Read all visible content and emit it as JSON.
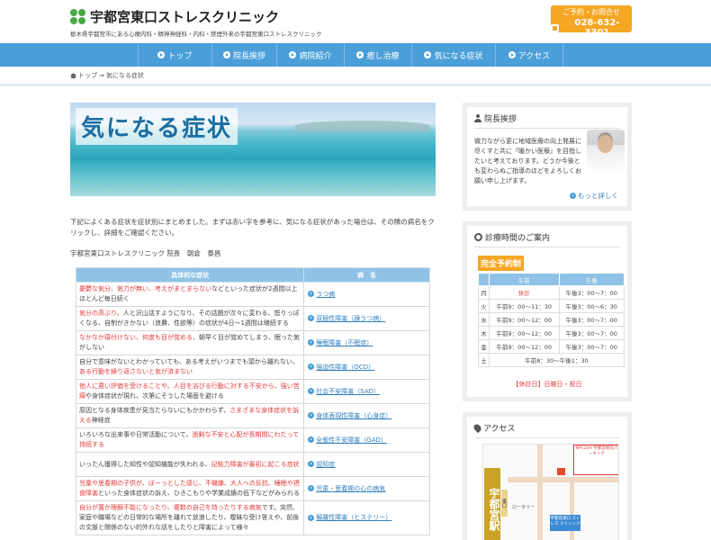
{
  "header": {
    "site_title": "宇都宮東口ストレスクリニック",
    "tagline": "栃木県宇都宮市にある心療内科・精神神経科・内科・禁煙外来の宇都宮東口ストレスクリニック",
    "contact_label": "ご予約・お問合せ",
    "phone": "028-632-3301"
  },
  "nav": [
    {
      "label": "トップ"
    },
    {
      "label": "院長挨拶"
    },
    {
      "label": "病院紹介"
    },
    {
      "label": "癒し治療"
    },
    {
      "label": "気になる症状"
    },
    {
      "label": "アクセス"
    }
  ],
  "breadcrumb": {
    "home": "トップ",
    "separator": "⇒",
    "current": "気になる症状"
  },
  "hero_title": "気になる症状",
  "intro": "下記によくある症状を症状別にまとめました。まずは赤い字を参考に、気になる症状があった場合は、その隣の病名をクリックし、詳細をご確認ください。",
  "signature": "宇都宮東口ストレスクリニック 院長　朝倉　泰昌",
  "table": {
    "col1": "具体的な症状",
    "col2": "病　名",
    "rows": [
      {
        "pre": "",
        "red": "憂鬱な気分、気力が無い、考えがまとまらない",
        "post": "などといった症状が2週間以上ほとんど毎日続く",
        "disease": "うつ病"
      },
      {
        "pre": "",
        "red": "気分の高ぶり",
        "post": "、人と沢山話すようになり、その話題が次々に変わる、怒りっぽくなる、自制がきかない（浪費、性欲等）の症状が4日〜1週間は継続する",
        "disease": "双極性障害（躁うつ病）"
      },
      {
        "pre": "",
        "red": "なかなか寝付けない、何度も目が覚める",
        "post": "、朝早く目が覚めてしまう、眠った気がしない",
        "disease": "睡眠障害（不眠症）"
      },
      {
        "pre": "自分で意味がないとわかっていても、ある考えがいつまでも頭から離れない、",
        "red": "ある行動を繰り返さないと気が済まない",
        "post": "",
        "disease": "強迫性障害（OCD）"
      },
      {
        "pre": "",
        "red": "他人に悪い評価を受けることや、人目を浴びる行動に対する不安から、強い苦痛",
        "post": "や身体症状が現れ、次第にそうした場面を避ける",
        "disease": "社会不安障害（SAD）"
      },
      {
        "pre": "原因となる身体疾患が見当たらないにもかかわらず、",
        "red": "さまざまな身体症状を訴える",
        "post": "神経症",
        "disease": "身体表現性障害（心身症）"
      },
      {
        "pre": "いろいろな出来事や日常活動について、",
        "red": "過剰な不安と心配が長期間にわたって持続する",
        "post": "",
        "disease": "全般性不安障害（GAD）"
      },
      {
        "pre": "いったん獲得した知性や認知機能が失われる、",
        "red": "記銘力障害が最初に起こる症状",
        "post": "",
        "disease": "認知症"
      },
      {
        "pre": "",
        "red": "児童や思春期の子供が、ぼーっとした感じ、不機嫌、大人への反抗、睡眠や摂食障害",
        "post": "といった身体症状の訴え、ひきこもりや学業成績の低下などがみられる",
        "disease": "児童・思春期の心の病気"
      },
      {
        "pre": "",
        "red": "自分が置か理解不能になったり、複数の自己を持ったりする病気",
        "post": "です。突然、家庭や職場などの日常的な場所を離れて放浪したり、曖昧な受け答えや、前後の文脈と関係のない的外れな話をしたりと障害によって様々",
        "disease": "解離性障害（ヒステリー）"
      }
    ]
  },
  "greeting": {
    "title": "院長挨拶",
    "text": "微力ながら更に地域医療の向上発展に尽くすと共に『暖かい医療』を目指したいと考えております。どうか今後とも変わらぬご指導のほどをよろしくお願い申し上げます。",
    "more": "もっと詳しく"
  },
  "hours": {
    "title": "診療時間のご案内",
    "badge": "完全予約制",
    "head": [
      "午前",
      "午後"
    ],
    "rows": [
      {
        "day": "月",
        "am": "休診",
        "pm": "午後3：00〜7：00",
        "closed": true
      },
      {
        "day": "火",
        "am": "午前9：00〜11：30",
        "pm": "午後3：00〜6：30"
      },
      {
        "day": "水",
        "am": "午前9：00〜12：00",
        "pm": "午後3：00〜7：00"
      },
      {
        "day": "木",
        "am": "午前9：00〜12：00",
        "pm": "午後3：00〜7：00"
      },
      {
        "day": "金",
        "am": "午前9：00〜12：00",
        "pm": "午後3：00〜7：00"
      },
      {
        "day": "土",
        "both": "午前8：30〜午後1：30"
      }
    ],
    "note": "【休診日】日曜日・祝日"
  },
  "access": {
    "title": "アクセス",
    "station": "宇都宮駅",
    "exit": "東口",
    "rotary": "ロータリー",
    "parking": "NPC24H 宇都宮駅前パーキング",
    "clinic": "宇都宮東口 ストレス クリニック"
  },
  "colors": {
    "nav": "#4a9fd9",
    "accent": "#f5a623",
    "red": "#e23a3a",
    "link": "#2f7fc0"
  }
}
